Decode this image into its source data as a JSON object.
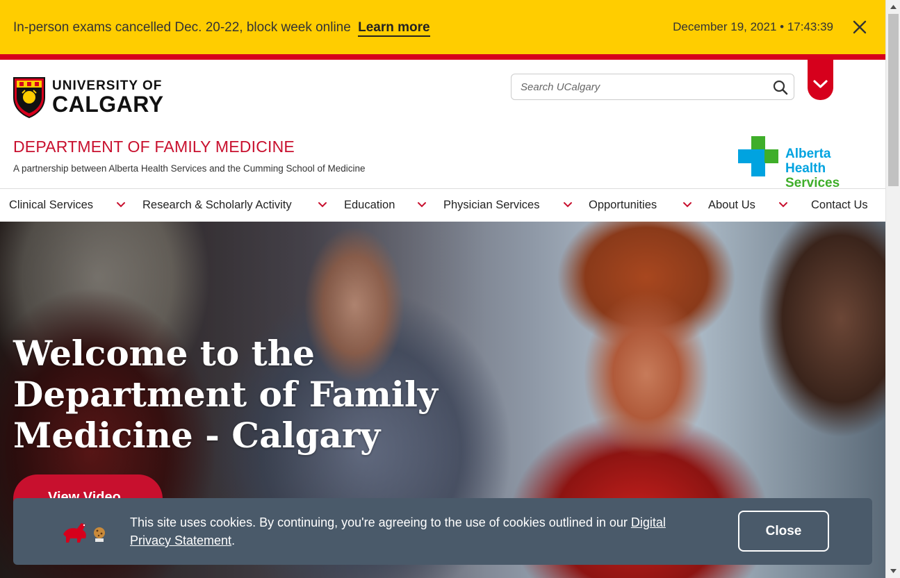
{
  "alert": {
    "message": "In-person exams cancelled Dec. 20-22, block week online",
    "link_label": "Learn more",
    "datetime": "December 19, 2021 • 17:43:39"
  },
  "header": {
    "logo_line1": "UNIVERSITY OF",
    "logo_line2": "CALGARY",
    "search_placeholder": "Search UCalgary",
    "department_title": "DEPARTMENT OF FAMILY MEDICINE",
    "department_subtitle": "A partnership between Alberta Health Services and the Cumming School of Medicine",
    "partner_logo_line1": "Alberta Health",
    "partner_logo_line2": "Services"
  },
  "nav": {
    "items": [
      {
        "label": "Clinical Services"
      },
      {
        "label": "Research & Scholarly Activity"
      },
      {
        "label": "Education"
      },
      {
        "label": "Physician Services"
      },
      {
        "label": "Opportunities"
      },
      {
        "label": "About Us"
      },
      {
        "label": "Contact Us"
      }
    ]
  },
  "hero": {
    "title": "Welcome to the Department of Family Medicine - Calgary",
    "button_label": "View Video"
  },
  "cookie": {
    "text": "This site uses cookies. By continuing, you're agreeing to the use of cookies outlined in our ",
    "link_label": "Digital Privacy Statement",
    "text_end": ".",
    "close_label": "Close"
  },
  "colors": {
    "alert_yellow": "#ffcd00",
    "brand_red": "#d6001c",
    "dept_red": "#c8102e",
    "cookie_bg": "#4a5a6a",
    "ahs_blue": "#00a3e0",
    "ahs_green": "#3fae2a"
  }
}
